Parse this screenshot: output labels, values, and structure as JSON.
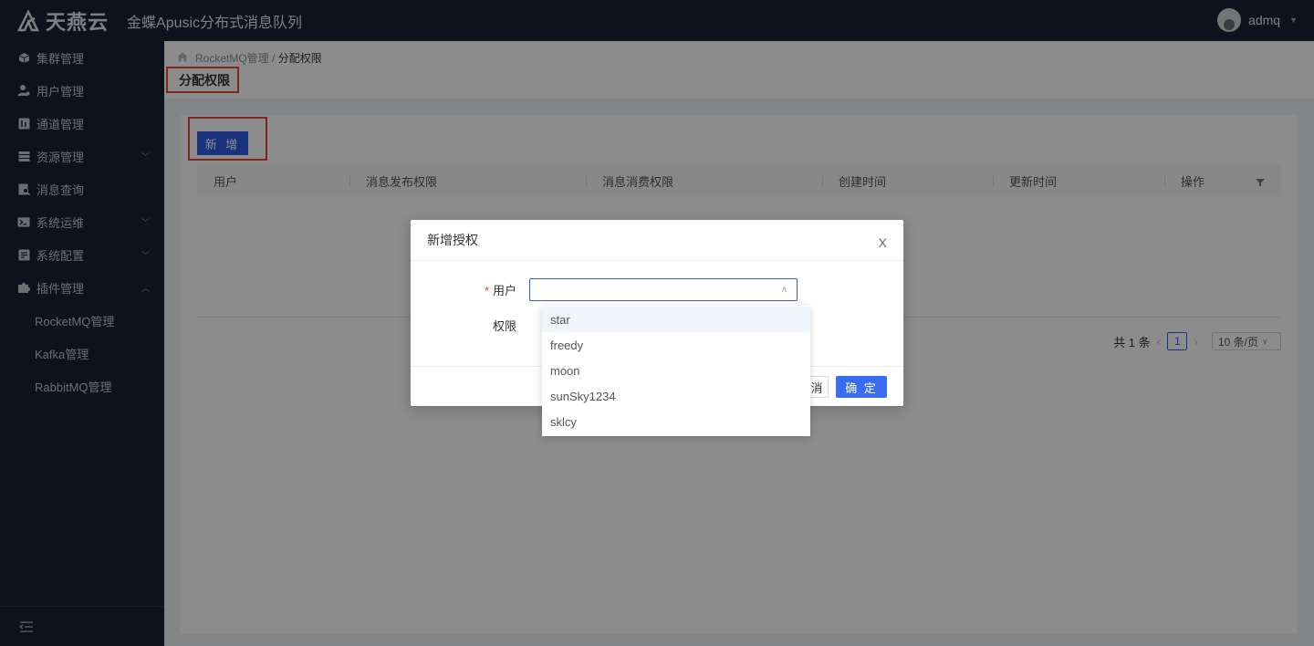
{
  "header": {
    "logo_text": "天燕云",
    "app_title": "金蝶Apusic分布式消息队列",
    "username": "admq"
  },
  "sidebar": {
    "items": [
      {
        "label": "集群管理",
        "icon": "cube-icon"
      },
      {
        "label": "用户管理",
        "icon": "user-icon"
      },
      {
        "label": "通道管理",
        "icon": "channel-icon"
      },
      {
        "label": "资源管理",
        "icon": "list-icon",
        "expandable": true
      },
      {
        "label": "消息查询",
        "icon": "search-doc-icon"
      },
      {
        "label": "系统运维",
        "icon": "terminal-icon",
        "expandable": true
      },
      {
        "label": "系统配置",
        "icon": "config-icon",
        "expandable": true
      },
      {
        "label": "插件管理",
        "icon": "puzzle-icon",
        "expanded": true
      }
    ],
    "sub_items": [
      "RocketMQ管理",
      "Kafka管理",
      "RabbitMQ管理"
    ]
  },
  "breadcrumb": {
    "parent": "RocketMQ管理",
    "separator": " / ",
    "current": "分配权限"
  },
  "page": {
    "title": "分配权限",
    "add_button": "新 增"
  },
  "table": {
    "columns": [
      "用户",
      "消息发布权限",
      "消息消费权限",
      "创建时间",
      "更新时间",
      "操作"
    ]
  },
  "pagination": {
    "total": "共 1 条",
    "current_page": "1",
    "page_size": "10 条/页"
  },
  "modal": {
    "title": "新增授权",
    "close": "X",
    "user_label": "用户",
    "required_mark": "*",
    "permission_label": "权限",
    "cancel_partial": "消",
    "ok_button": "确 定"
  },
  "dropdown": {
    "options": [
      "star",
      "freedy",
      "moon",
      "sunSky1234",
      "sklcy"
    ],
    "highlighted": "star"
  },
  "colors": {
    "sidebar_bg": "#1b2233",
    "primary": "#2f5ce0",
    "highlight_border": "#e64a35"
  }
}
